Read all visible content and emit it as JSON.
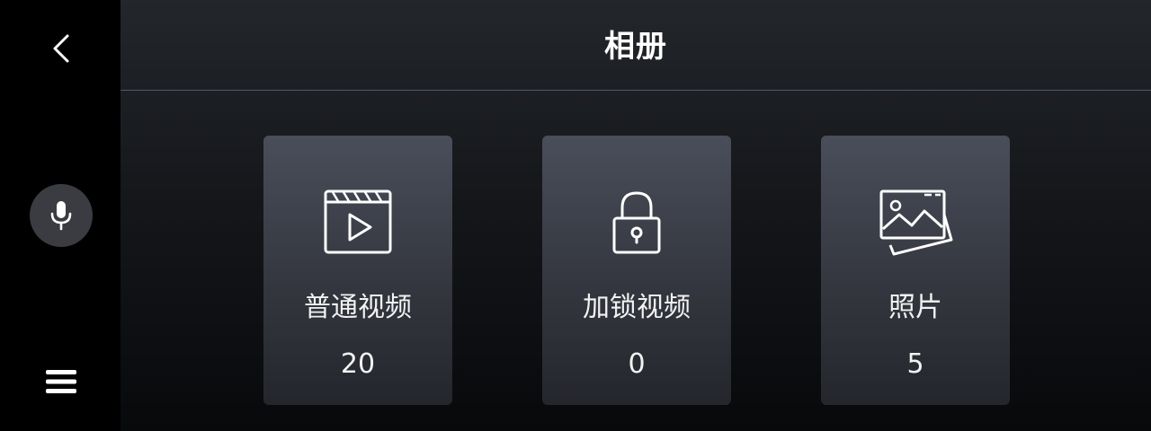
{
  "header": {
    "title": "相册"
  },
  "rail": {
    "back_icon": "chevron-left-icon",
    "mic_icon": "microphone-icon",
    "menu_icon": "hamburger-menu-icon"
  },
  "cards": [
    {
      "label": "普通视频",
      "count": "20",
      "icon": "video-clapper-play-icon"
    },
    {
      "label": "加锁视频",
      "count": "0",
      "icon": "padlock-icon"
    },
    {
      "label": "照片",
      "count": "5",
      "icon": "photo-stack-icon"
    }
  ],
  "colors": {
    "background": "#000000",
    "card_top": "#4a4e5a",
    "card_bottom": "#24262c",
    "mic_button": "#3a3c41",
    "text": "#ffffff"
  }
}
